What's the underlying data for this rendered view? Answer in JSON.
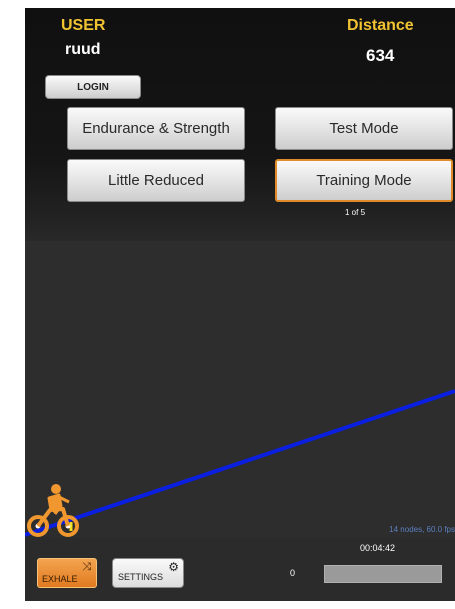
{
  "header": {
    "user_label": "USER",
    "user_name": "ruud",
    "login_label": "LOGIN",
    "distance_label": "Distance",
    "distance_value": "634"
  },
  "modes": {
    "endurance": "Endurance & Strength",
    "test": "Test Mode",
    "little": "Little Reduced",
    "training": "Training Mode",
    "selected": "Training Mode",
    "page_indicator": "1 of 5"
  },
  "graph": {
    "nodes_info": "14 nodes, 60.0 fps",
    "line_color": "#0a1fe0",
    "accent_color": "#f0972f"
  },
  "footer": {
    "elapsed_time": "00:04:42",
    "exhale_label": "EXHALE",
    "settings_label": "SETTINGS",
    "counter": "0",
    "progress": 0
  },
  "icons": {
    "cyclist": "cyclist-icon",
    "shuffle": "shuffle-icon",
    "gear": "gear-icon"
  }
}
